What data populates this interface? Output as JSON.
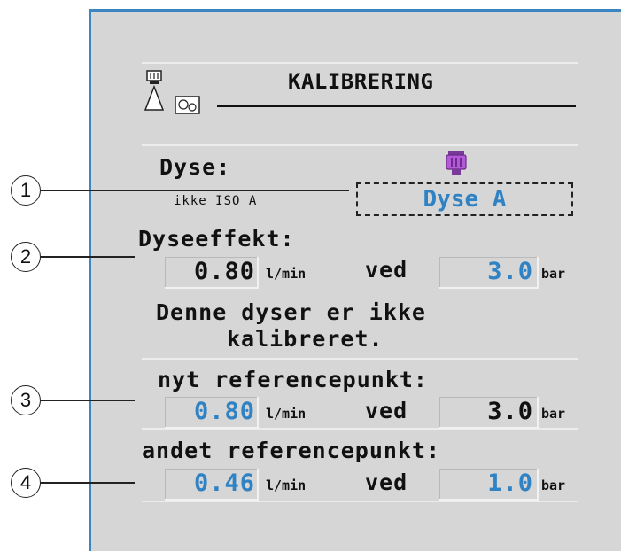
{
  "header": {
    "title": "KALIBRERING"
  },
  "nozzle": {
    "label": "Dyse:",
    "iso_text": "ikke ISO A",
    "selected": "Dyse A",
    "color": "#b35bd6"
  },
  "output": {
    "label": "Dyseeffekt:",
    "flow": "0.80",
    "flow_unit": "l/min",
    "at": "ved",
    "pressure": "3.0",
    "pressure_unit": "bar"
  },
  "message": {
    "line1": "Denne dyser er ikke",
    "line2": "kalibreret."
  },
  "new_ref": {
    "label": "nyt referencepunkt:",
    "flow": "0.80",
    "flow_unit": "l/min",
    "at": "ved",
    "pressure": "3.0",
    "pressure_unit": "bar"
  },
  "other_ref": {
    "label": "andet referencepunkt:",
    "flow": "0.46",
    "flow_unit": "l/min",
    "at": "ved",
    "pressure": "1.0",
    "pressure_unit": "bar"
  },
  "callouts": [
    "1",
    "2",
    "3",
    "4"
  ],
  "colors": {
    "accent_blue": "#2f82c4",
    "frame_blue": "#3b86c2",
    "panel": "#d6d6d6"
  },
  "icons": {
    "header": "nozzle-calibration-icon",
    "nozzle": "nozzle-icon"
  }
}
